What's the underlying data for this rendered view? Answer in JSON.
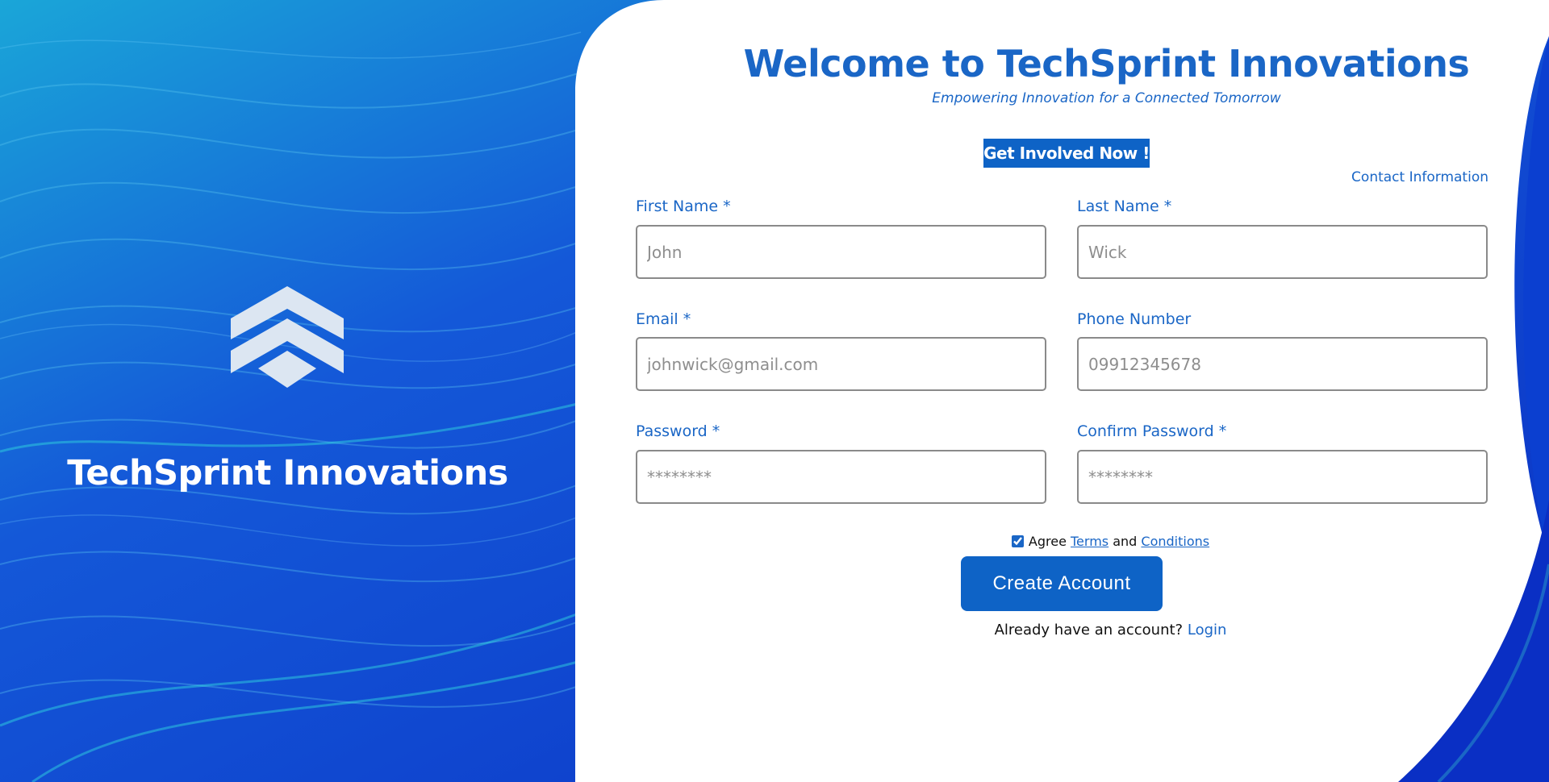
{
  "brand": {
    "name": "TechSprint Innovations",
    "logo_icon": "chevron-stack-logo"
  },
  "header": {
    "title": "Welcome to TechSprint Innovations",
    "subtitle": "Empowering Innovation for a Connected Tomorrow",
    "cta_label": "Get Involved Now !",
    "contact_link": "Contact Information"
  },
  "form": {
    "first_name": {
      "label": "First Name *",
      "placeholder": "John",
      "value": ""
    },
    "last_name": {
      "label": "Last Name *",
      "placeholder": "Wick",
      "value": ""
    },
    "email": {
      "label": "Email *",
      "placeholder": "johnwick@gmail.com",
      "value": ""
    },
    "phone": {
      "label": "Phone Number",
      "placeholder": "09912345678",
      "value": ""
    },
    "password": {
      "label": "Password *",
      "placeholder": "********",
      "value": ""
    },
    "confirm_password": {
      "label": "Confirm Password *",
      "placeholder": "********",
      "value": ""
    },
    "agree": {
      "checked": true,
      "prefix": "Agree",
      "terms": "Terms",
      "and": "and",
      "conditions": "Conditions"
    },
    "submit_label": "Create Account",
    "login_prompt": "Already have an account?",
    "login_link": "Login"
  },
  "colors": {
    "accent": "#1a66c6",
    "button": "#0e63c6",
    "background_blue": "#0b3fd0"
  }
}
